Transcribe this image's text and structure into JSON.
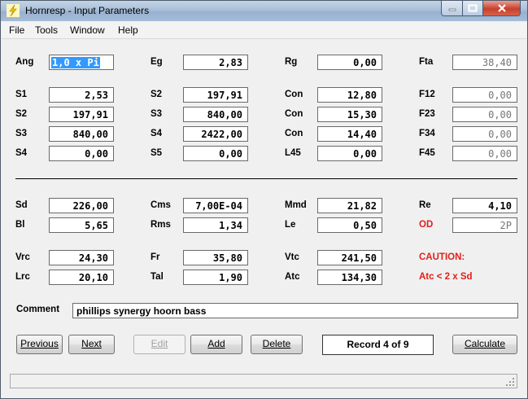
{
  "window": {
    "title": "Hornresp - Input Parameters"
  },
  "menu": [
    "File",
    "Tools",
    "Window",
    "Help"
  ],
  "fields": {
    "ang": {
      "label": "Ang",
      "value": "1,0 x Pi"
    },
    "eg": {
      "label": "Eg",
      "value": "2,83"
    },
    "rg": {
      "label": "Rg",
      "value": "0,00"
    },
    "fta": {
      "label": "Fta",
      "value": "38,40"
    },
    "s1": {
      "label": "S1",
      "value": "2,53"
    },
    "s2a": {
      "label": "S2",
      "value": "197,91"
    },
    "con1": {
      "label": "Con",
      "value": "12,80"
    },
    "f12": {
      "label": "F12",
      "value": "0,00"
    },
    "s2b": {
      "label": "S2",
      "value": "197,91"
    },
    "s3a": {
      "label": "S3",
      "value": "840,00"
    },
    "con2": {
      "label": "Con",
      "value": "15,30"
    },
    "f23": {
      "label": "F23",
      "value": "0,00"
    },
    "s3b": {
      "label": "S3",
      "value": "840,00"
    },
    "s4a": {
      "label": "S4",
      "value": "2422,00"
    },
    "con3": {
      "label": "Con",
      "value": "14,40"
    },
    "f34": {
      "label": "F34",
      "value": "0,00"
    },
    "s4b": {
      "label": "S4",
      "value": "0,00"
    },
    "s5": {
      "label": "S5",
      "value": "0,00"
    },
    "l45": {
      "label": "L45",
      "value": "0,00"
    },
    "f45": {
      "label": "F45",
      "value": "0,00"
    },
    "sd": {
      "label": "Sd",
      "value": "226,00"
    },
    "cms": {
      "label": "Cms",
      "value": "7,00E-04"
    },
    "mmd": {
      "label": "Mmd",
      "value": "21,82"
    },
    "re": {
      "label": "Re",
      "value": "4,10"
    },
    "bl": {
      "label": "Bl",
      "value": "5,65"
    },
    "rms": {
      "label": "Rms",
      "value": "1,34"
    },
    "le": {
      "label": "Le",
      "value": "0,50"
    },
    "od": {
      "label": "OD",
      "value": "2P"
    },
    "vrc": {
      "label": "Vrc",
      "value": "24,30"
    },
    "fr": {
      "label": "Fr",
      "value": "35,80"
    },
    "vtc": {
      "label": "Vtc",
      "value": "241,50"
    },
    "lrc": {
      "label": "Lrc",
      "value": "20,10"
    },
    "tal": {
      "label": "Tal",
      "value": "1,90"
    },
    "atc": {
      "label": "Atc",
      "value": "134,30"
    }
  },
  "caution": {
    "title": "CAUTION:",
    "message": "Atc < 2 x Sd"
  },
  "comment": {
    "label": "Comment",
    "value": "phillips synergy hoorn bass"
  },
  "buttons": {
    "previous": "Previous",
    "next": "Next",
    "edit": "Edit",
    "add": "Add",
    "delete": "Delete",
    "calculate": "Calculate"
  },
  "record": "Record 4 of 9",
  "colors": {
    "accent_red": "#e0201b",
    "selection": "#3399ff"
  },
  "icons": {
    "app": "lightning-icon"
  }
}
